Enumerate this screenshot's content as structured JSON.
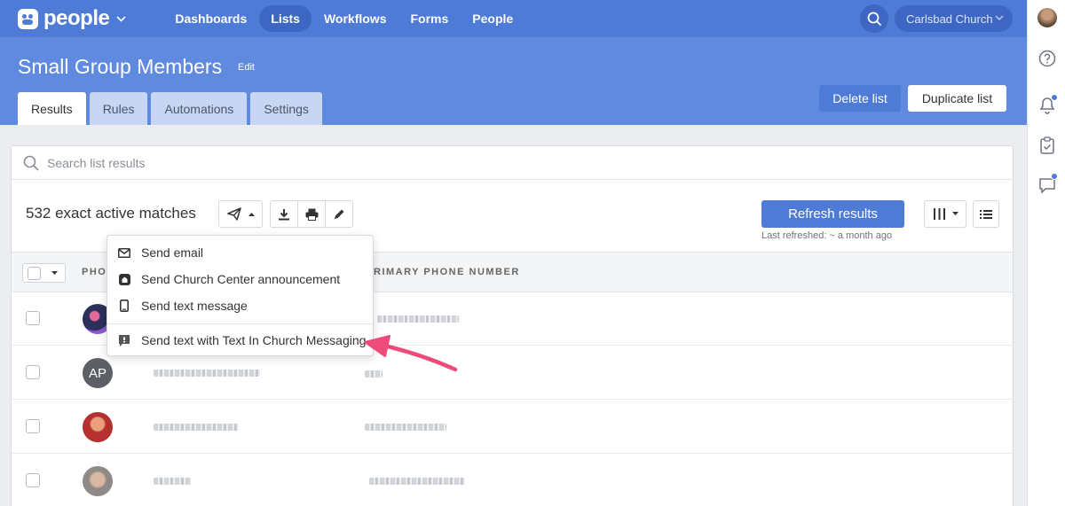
{
  "brand": {
    "name": "people"
  },
  "nav": {
    "items": [
      {
        "label": "Dashboards",
        "active": false
      },
      {
        "label": "Lists",
        "active": true
      },
      {
        "label": "Workflows",
        "active": false
      },
      {
        "label": "Forms",
        "active": false
      },
      {
        "label": "People",
        "active": false
      }
    ],
    "org": "Carlsbad Church"
  },
  "header": {
    "title": "Small Group Members",
    "edit": "Edit",
    "tabs": [
      {
        "label": "Results",
        "active": true
      },
      {
        "label": "Rules",
        "active": false
      },
      {
        "label": "Automations",
        "active": false
      },
      {
        "label": "Settings",
        "active": false
      }
    ],
    "delete_label": "Delete list",
    "duplicate_label": "Duplicate list"
  },
  "search": {
    "placeholder": "Search list results",
    "value": ""
  },
  "results": {
    "matches": "532 exact active matches",
    "refresh_label": "Refresh results",
    "last_refreshed": "Last refreshed: ~ a month ago"
  },
  "table": {
    "columns": [
      "PHO",
      "RIMARY PHONE NUMBER"
    ],
    "rows": [
      {
        "avatar": "photo"
      },
      {
        "avatar": "AP"
      },
      {
        "avatar": "photo"
      },
      {
        "avatar": "photo"
      }
    ]
  },
  "dropdown": {
    "items": [
      {
        "label": "Send email",
        "icon": "envelope-icon"
      },
      {
        "label": "Send Church Center announcement",
        "icon": "church-center-icon"
      },
      {
        "label": "Send text message",
        "icon": "phone-icon"
      },
      {
        "label": "Send text with Text In Church Messaging",
        "icon": "message-square-icon"
      }
    ]
  },
  "colors": {
    "nav_bg": "#4e7bd6",
    "header_bg": "#5f8ae0",
    "accent": "#4e7bd6",
    "annotation_arrow": "#ee4a7a"
  }
}
